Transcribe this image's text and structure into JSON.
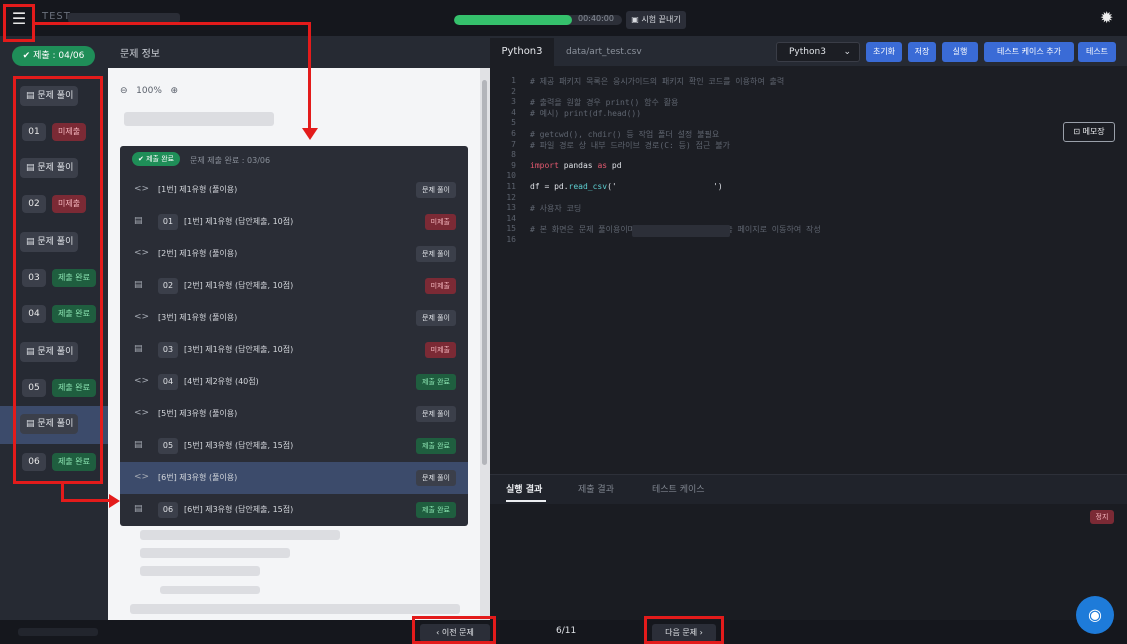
{
  "app": {
    "title": "TEST",
    "progress": 0.7,
    "timer": "00:40:00",
    "end_exam_label": "시험 끝내기",
    "end_exam_icon": "end-exam-icon"
  },
  "sidebar": {
    "submit_count": "제출 : 04/06",
    "solve_label": "문제 풀이",
    "items": [
      {
        "type": "solve",
        "label": "문제 풀이"
      },
      {
        "type": "question",
        "num": "01",
        "status": "미제출",
        "status_color": "red"
      },
      {
        "type": "solve",
        "label": "문제 풀이"
      },
      {
        "type": "question",
        "num": "02",
        "status": "미제출",
        "status_color": "red"
      },
      {
        "type": "solve",
        "label": "문제 풀이"
      },
      {
        "type": "question",
        "num": "03",
        "status": "제출 완료",
        "status_color": "green"
      },
      {
        "type": "question",
        "num": "04",
        "status": "제출 완료",
        "status_color": "green"
      },
      {
        "type": "solve",
        "label": "문제 풀이"
      },
      {
        "type": "question",
        "num": "05",
        "status": "제출 완료",
        "status_color": "green"
      },
      {
        "type": "solve",
        "label": "문제 풀이",
        "selected": true
      },
      {
        "type": "question",
        "num": "06",
        "status": "제출 완료",
        "status_color": "green"
      }
    ]
  },
  "problem": {
    "header": "문제 정보",
    "zoom": "100%",
    "dropdown": {
      "badge": "제출 완료",
      "summary": "문제 제출 완료 : 03/06",
      "rows": [
        {
          "glyph": "<>",
          "num": "",
          "text": "[1번] 제1유형 (풀이용)",
          "status": "문제 풀이",
          "status_color": "gray"
        },
        {
          "glyph": "▤",
          "num": "01",
          "text": "[1번] 제1유형 (답안제출, 10점)",
          "status": "미제출",
          "status_color": "red"
        },
        {
          "glyph": "<>",
          "num": "",
          "text": "[2번] 제1유형 (풀이용)",
          "status": "문제 풀이",
          "status_color": "gray"
        },
        {
          "glyph": "▤",
          "num": "02",
          "text": "[2번] 제1유형 (답안제출, 10점)",
          "status": "미제출",
          "status_color": "red"
        },
        {
          "glyph": "<>",
          "num": "",
          "text": "[3번] 제1유형 (풀이용)",
          "status": "문제 풀이",
          "status_color": "gray"
        },
        {
          "glyph": "▤",
          "num": "03",
          "text": "[3번] 제1유형 (답안제출, 10점)",
          "status": "미제출",
          "status_color": "red"
        },
        {
          "glyph": "<>",
          "num": "04",
          "text": "[4번] 제2유형 (40점)",
          "status": "제출 완료",
          "status_color": "green"
        },
        {
          "glyph": "<>",
          "num": "",
          "text": "[5번] 제3유형 (풀이용)",
          "status": "문제 풀이",
          "status_color": "gray"
        },
        {
          "glyph": "▤",
          "num": "05",
          "text": "[5번] 제3유형 (답안제출, 15점)",
          "status": "제출 완료",
          "status_color": "green"
        },
        {
          "glyph": "<>",
          "num": "",
          "text": "[6번] 제3유형 (풀이용)",
          "status": "문제 풀이",
          "status_color": "gray",
          "selected": true
        },
        {
          "glyph": "▤",
          "num": "06",
          "text": "[6번] 제3유형 (답안제출, 15점)",
          "status": "제출 완료",
          "status_color": "green"
        }
      ]
    }
  },
  "editor": {
    "tab_active": "Python3",
    "tab_file": "data/art_test.csv",
    "language": "Python3",
    "buttons": [
      "초기화",
      "저장",
      "실행",
      "테스트 케이스 추가",
      "테스트"
    ],
    "memo_label": "메모장",
    "lines": [
      {
        "n": "1",
        "segs": [
          [
            "cm",
            "# 제공 패키지 목록은 응시가이드의 패키지 확인 코드를 이용하여 출력"
          ]
        ]
      },
      {
        "n": "2",
        "segs": []
      },
      {
        "n": "3",
        "segs": [
          [
            "cm",
            "# 출력을 원할 경우 print() 함수 활용"
          ]
        ]
      },
      {
        "n": "4",
        "segs": [
          [
            "cm",
            "# 예시) print(df.head())"
          ]
        ]
      },
      {
        "n": "5",
        "segs": []
      },
      {
        "n": "6",
        "segs": [
          [
            "cm",
            "# getcwd(), chdir() 등 작업 폴더 설정 불필요"
          ]
        ]
      },
      {
        "n": "7",
        "segs": [
          [
            "cm",
            "# 파일 경로 상 내부 드라이브 경로(C: 등) 접근 불가"
          ]
        ]
      },
      {
        "n": "8",
        "segs": []
      },
      {
        "n": "9",
        "segs": [
          [
            "kw",
            "import"
          ],
          [
            "tx",
            " pandas "
          ],
          [
            "kw",
            "as"
          ],
          [
            "tx",
            " pd"
          ]
        ]
      },
      {
        "n": "10",
        "segs": []
      },
      {
        "n": "11",
        "segs": [
          [
            "tx",
            "df = pd."
          ],
          [
            "fn",
            "read_csv"
          ],
          [
            "tx",
            "('                    ')"
          ]
        ]
      },
      {
        "n": "12",
        "segs": []
      },
      {
        "n": "13",
        "segs": [
          [
            "cm",
            "# 사용자 코딩"
          ]
        ]
      },
      {
        "n": "14",
        "segs": []
      },
      {
        "n": "15",
        "segs": [
          [
            "cm",
            "# 본 화면은 문제 풀이용이며, 풀이한 답안은 답안 제출 페이지로 이동하여 작성"
          ]
        ]
      },
      {
        "n": "16",
        "segs": []
      }
    ]
  },
  "results": {
    "tabs": [
      "실행 결과",
      "제출 결과",
      "테스트 케이스"
    ],
    "stop_label": "정지"
  },
  "footer": {
    "prev": "‹ 이전 문제",
    "pager": "6/11",
    "next": "다음 문제 ›"
  },
  "colors": {
    "accent": "#3a6bd6",
    "green": "#1f8e58",
    "red": "#7b2a35",
    "annotation": "#e31b1b"
  }
}
